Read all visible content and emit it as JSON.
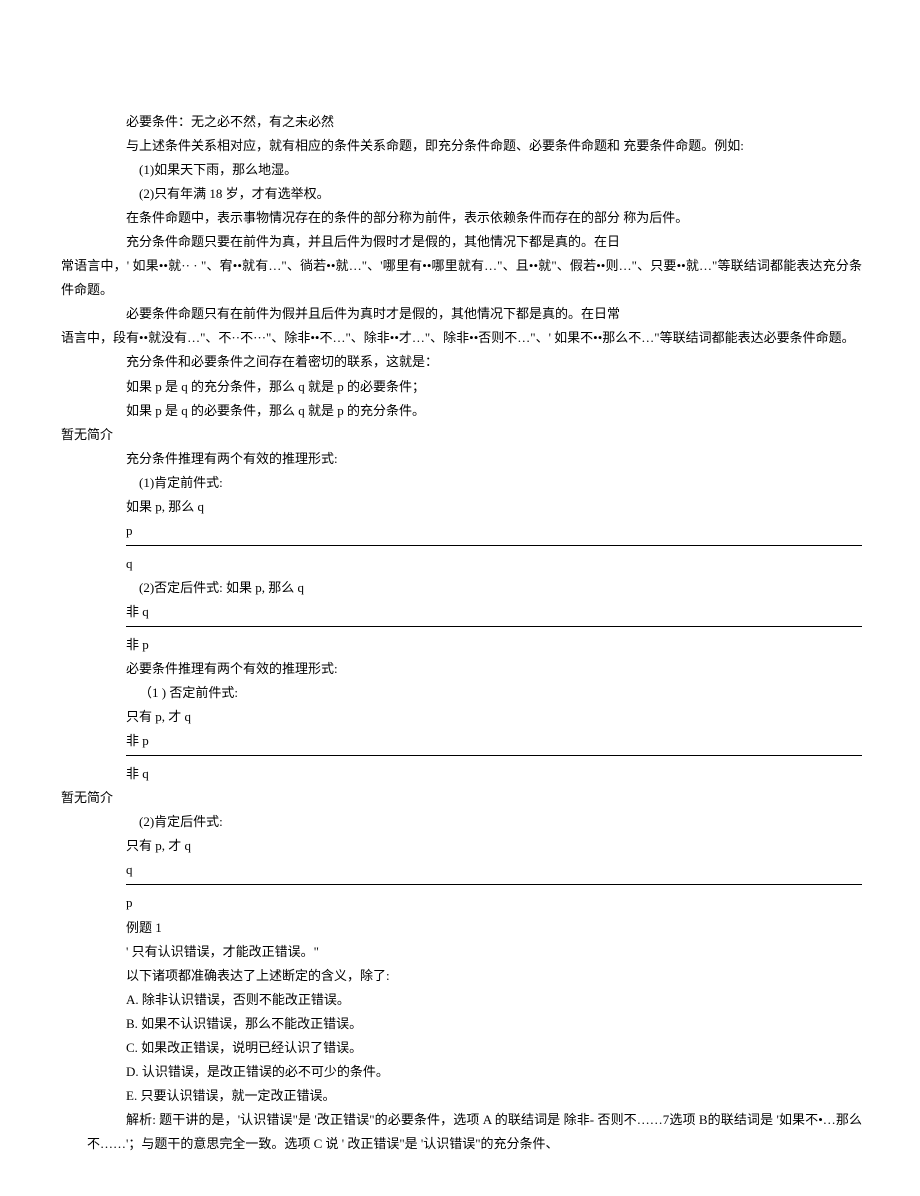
{
  "lines": {
    "l1": "必要条件：无之必不然，有之未必然",
    "l2": "与上述条件关系相对应，就有相应的条件关系命题，即充分条件命题、必要条件命题和 充要条件命题。例如:",
    "l3": "(1)如果天下雨，那么地湿。",
    "l4": "(2)只有年满 18 岁，才有选举权。",
    "l5": "在条件命题中，表示事物情况存在的条件的部分称为前件，表示依赖条件而存在的部分 称为后件。",
    "l6": "充分条件命题只要在前件为真，并且后件为假时才是假的，其他情况下都是真的。在日",
    "l7": "常语言中，' 如果••就·· · \"、宥••就有…\"、徜若••就…\"、'哪里有••哪里就有…\"、且••就\"、假若••则…\"、只要••就…\"等联结词都能表达充分条件命题。",
    "l8": "必要条件命题只有在前件为假并且后件为真时才是假的，其他情况下都是真的。在日常",
    "l9": "语言中，段有••就没有…\"、不··不···\"、除非••不…\"、除非••才…\"、除非••否则不…\"、' 如果不••那么不…\"等联结词都能表达必要条件命题。",
    "l10": "充分条件和必要条件之间存在着密切的联系，这就是：",
    "l11": "如果 p 是 q 的充分条件，那么 q 就是 p 的必要条件；",
    "l12": "如果 p 是 q 的必要条件，那么 q 就是 p 的充分条件。",
    "l13": "暂无简介",
    "l14": "充分条件推理有两个有效的推理形式:",
    "l15": "(1)肯定前件式:",
    "l16": "如果 p, 那么 q",
    "l17": "p",
    "l18": "q",
    "l19": "(2)否定后件式: 如果 p, 那么 q",
    "l20": "非 q",
    "l21": "非 p",
    "l22": "必要条件推理有两个有效的推理形式:",
    "l23": "（1 ) 否定前件式:",
    "l24": "只有 p, 才 q",
    "l25": "非 p",
    "l26": "非 q",
    "l27": "暂无简介",
    "l28": "(2)肯定后件式:",
    "l29": "只有 p, 才 q",
    "l30": "q",
    "l31": "p",
    "l32": "例题 1",
    "l33": "' 只有认识错误，才能改正错误。\"",
    "l34": "以下诸项都准确表达了上述断定的含义，除了:",
    "l35": "A. 除非认识错误，否则不能改正错误。",
    "l36": "B. 如果不认识错误，那么不能改正错误。",
    "l37": "C. 如果改正错误，说明已经认识了错误。",
    "l38": "D. 认识错误，是改正错误的必不可少的条件。",
    "l39": "E. 只要认识错误，就一定改正错误。",
    "l40": "解析: 题干讲的是，'认识错误\"是 '改正错误\"的必要条件，选项 A 的联结词是 除非- 否则不……7选项 B的联结词是 '如果不•…那么不……'；与题干的意思完全一致。选项 C 说 ' 改正错误\"是 '认识错误\"的充分条件、"
  }
}
